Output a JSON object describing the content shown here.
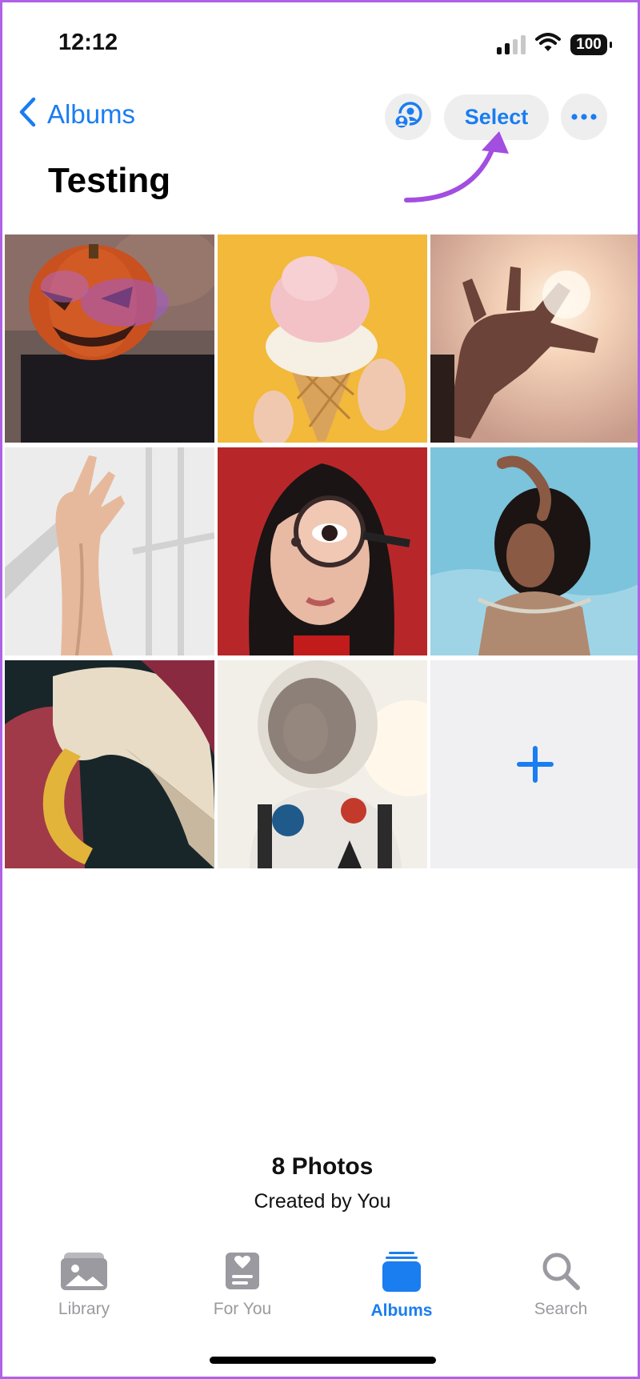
{
  "status_bar": {
    "time": "12:12",
    "battery": "100",
    "icons": [
      "cellular-signal-icon",
      "wifi-icon",
      "battery-icon"
    ]
  },
  "nav": {
    "back_label": "Albums",
    "shared_icon": "person-circle-icon",
    "select_label": "Select",
    "more_icon": "ellipsis-icon"
  },
  "album": {
    "title": "Testing",
    "count": "8 Photos",
    "creator": "Created by You"
  },
  "photos": [
    {
      "subject": "pumpkin-head person"
    },
    {
      "subject": "ice cream cone"
    },
    {
      "subject": "hand in sunlight"
    },
    {
      "subject": "raised hand"
    },
    {
      "subject": "woman with magnifying glass"
    },
    {
      "subject": "woman in water"
    },
    {
      "subject": "flower petal close-up"
    },
    {
      "subject": "astronaut"
    }
  ],
  "add_tile_icon": "plus-icon",
  "tabs": [
    {
      "label": "Library",
      "icon": "photo-library-icon",
      "active": false
    },
    {
      "label": "For You",
      "icon": "for-you-icon",
      "active": false
    },
    {
      "label": "Albums",
      "icon": "albums-icon",
      "active": true
    },
    {
      "label": "Search",
      "icon": "search-icon",
      "active": false
    }
  ],
  "colors": {
    "accent": "#1a7df0",
    "annotation_arrow": "#a24ee0",
    "frame": "#b061e8"
  }
}
